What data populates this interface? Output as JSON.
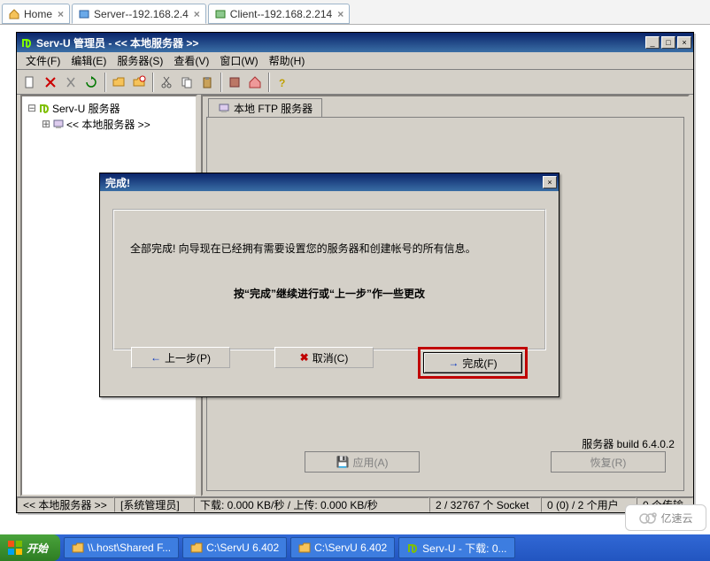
{
  "tabs": [
    {
      "icon": "home",
      "label": "Home",
      "active": false
    },
    {
      "icon": "server",
      "label": "Server--192.168.2.4",
      "active": true
    },
    {
      "icon": "client",
      "label": "Client--192.168.2.214",
      "active": false
    }
  ],
  "window": {
    "title": "Serv-U 管理员 - << 本地服务器 >>",
    "menus": [
      "文件(F)",
      "编辑(E)",
      "服务器(S)",
      "查看(V)",
      "窗口(W)",
      "帮助(H)"
    ]
  },
  "tree": {
    "root": "Serv-U 服务器",
    "child": "<< 本地服务器 >>"
  },
  "right": {
    "tab": "本地 FTP 服务器",
    "build": "服务器 build 6.4.0.2",
    "apply": "应用(A)",
    "applyIcon": "💾",
    "recover": "恢复(R)"
  },
  "dialog": {
    "title": "完成!",
    "line1": "全部完成! 向导现在已经拥有需要设置您的服务器和创建帐号的所有信息。",
    "line2": "按“完成”继续进行或“上一步”作一些更改",
    "back": "上一步(P)",
    "cancel": "取消(C)",
    "finish": "完成(F)"
  },
  "status": {
    "seg1": "<< 本地服务器 >>",
    "seg2": "[系统管理员]",
    "seg3": "下载: 0.000 KB/秒 / 上传: 0.000 KB/秒",
    "seg4": "2 / 32767 个 Socket",
    "seg5": "0 (0) / 2 个用户",
    "seg6": "0 个传输"
  },
  "taskbar": {
    "start": "开始",
    "items": [
      {
        "icon": "folder",
        "label": "\\\\.host\\Shared F..."
      },
      {
        "icon": "folder",
        "label": "C:\\ServU 6.402"
      },
      {
        "icon": "folder",
        "label": "C:\\ServU 6.402"
      },
      {
        "icon": "servu",
        "label": "Serv-U - 下载: 0..."
      }
    ]
  },
  "watermark": "亿速云"
}
